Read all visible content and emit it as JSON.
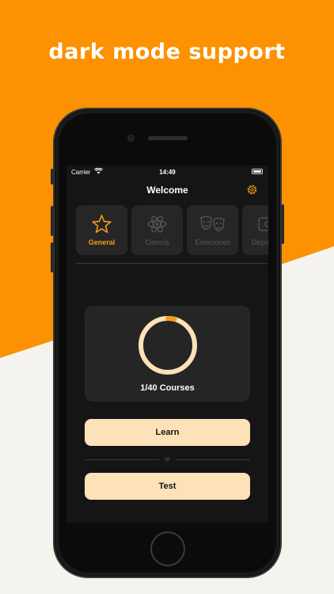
{
  "headline": "dark mode support",
  "colors": {
    "accent": "#f39c17",
    "orange_bg": "#fc9101",
    "button_bg": "#fde1b8",
    "screen_bg": "#151515",
    "card_bg": "#252525"
  },
  "status_bar": {
    "carrier": "Carrier",
    "time": "14:49",
    "wifi_icon": "wifi-icon",
    "battery_icon": "battery-icon"
  },
  "nav": {
    "title": "Welcome",
    "settings_icon": "gear-icon"
  },
  "categories": [
    {
      "label": "General",
      "icon": "star-icon",
      "selected": true
    },
    {
      "label": "Ciencia",
      "icon": "atom-icon",
      "selected": false
    },
    {
      "label": "Emociones",
      "icon": "theater-masks-icon",
      "selected": false
    },
    {
      "label": "Depo",
      "icon": "category-icon",
      "selected": false
    }
  ],
  "progress": {
    "completed": 1,
    "total": 40,
    "fraction": 0.025,
    "label": "1/40 Courses"
  },
  "actions": {
    "learn_label": "Learn",
    "or_label": "or",
    "test_label": "Test"
  }
}
